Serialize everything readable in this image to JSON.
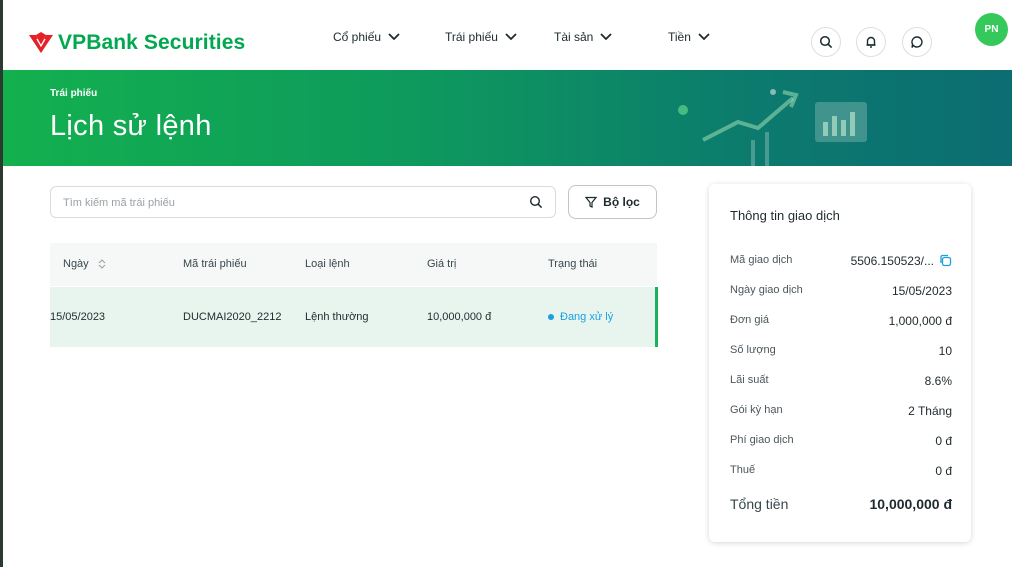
{
  "brand": {
    "name": "VPBank Securities",
    "accent": "#00a84f",
    "logo_red": "#e52027"
  },
  "nav": [
    {
      "label": "Cổ phiếu"
    },
    {
      "label": "Trái phiếu"
    },
    {
      "label": "Tài sản"
    },
    {
      "label": "Tiền"
    }
  ],
  "header_icons": [
    "search-icon",
    "bell-icon",
    "chat-icon"
  ],
  "user": {
    "initials": "PN"
  },
  "banner": {
    "subtitle": "Trái phiếu",
    "title": "Lịch sử lệnh"
  },
  "search": {
    "placeholder": "Tìm kiếm mã trái phiếu",
    "value": ""
  },
  "filter": {
    "label": "Bộ lọc"
  },
  "table": {
    "columns": [
      "Ngày",
      "Mã trái phiếu",
      "Loại lệnh",
      "Giá trị",
      "Trạng thái"
    ],
    "rows": [
      {
        "date": "15/05/2023",
        "code": "DUCMAI2020_2212",
        "type": "Lệnh thường",
        "value": "10,000,000 đ",
        "status": "Đang xử lý",
        "status_color": "#1a9fe0"
      }
    ]
  },
  "detail": {
    "title": "Thông tin giao dịch",
    "fields": [
      {
        "label": "Mã giao dịch",
        "value": "5506.150523/..."
      },
      {
        "label": "Ngày giao dịch",
        "value": "15/05/2023"
      },
      {
        "label": "Đơn giá",
        "value": "1,000,000 đ"
      },
      {
        "label": "Số lượng",
        "value": "10"
      },
      {
        "label": "Lãi suất",
        "value": "8.6%"
      },
      {
        "label": "Gói kỳ hạn",
        "value": "2 Tháng"
      },
      {
        "label": "Phí giao dịch",
        "value": "0 đ"
      },
      {
        "label": "Thuế",
        "value": "0 đ"
      }
    ],
    "total": {
      "label": "Tổng tiền",
      "value": "10,000,000 đ"
    }
  }
}
